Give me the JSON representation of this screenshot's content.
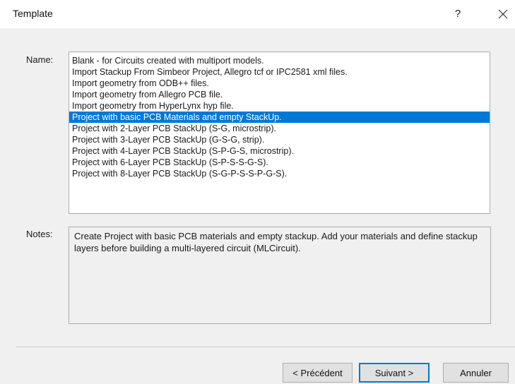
{
  "window": {
    "title": "Template",
    "help_label": "?"
  },
  "name_label": "Name:",
  "notes_label": "Notes:",
  "templates": [
    "Blank - for Circuits created with multiport models.",
    "Import Stackup From Simbeor Project, Allegro tcf or IPC2581 xml files.",
    "Import geometry from ODB++ files.",
    "Import geometry from Allegro PCB file.",
    "Import geometry from HyperLynx hyp file.",
    "Project with basic PCB Materials and empty StackUp.",
    "Project with 2-Layer PCB StackUp (S-G, microstrip).",
    "Project with 3-Layer PCB StackUp (G-S-G, strip).",
    "Project with 4-Layer PCB StackUp (S-P-G-S, microstrip).",
    "Project with 6-Layer PCB StackUp (S-P-S-S-G-S).",
    "Project with 8-Layer PCB StackUp (S-G-P-S-S-P-G-S)."
  ],
  "selected_index": 5,
  "notes_text": "Create Project with basic PCB materials and empty stackup. Add your materials and define stackup layers before building a multi-layered circuit (MLCircuit).",
  "buttons": {
    "back": "< Précédent",
    "next": "Suivant >",
    "cancel": "Annuler"
  },
  "colors": {
    "selection": "#0078d7",
    "dialog_bg": "#f0f0f0"
  }
}
